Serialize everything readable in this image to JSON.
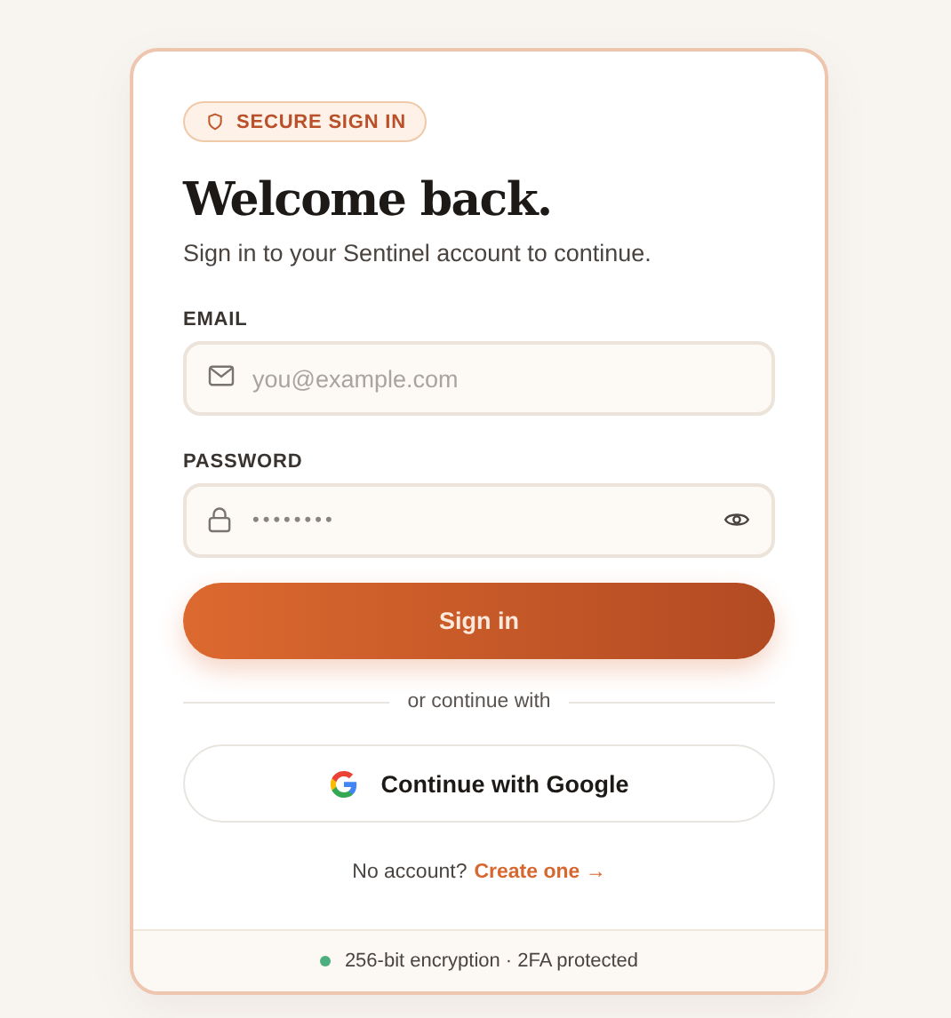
{
  "badge": "SECURE SIGN IN",
  "title": "Welcome back.",
  "subtitle": "Sign in to your Sentinel account to continue.",
  "fields": [
    {
      "kind": "email",
      "label": "EMAIL",
      "placeholder": "you@example.com"
    },
    {
      "kind": "password",
      "label": "PASSWORD",
      "value": "••••••••"
    }
  ],
  "submit": "Sign in",
  "divider": "or continue with",
  "google_button": "Continue with Google",
  "signup": {
    "prompt": "No account?",
    "link": "Create one →"
  },
  "footer": "256-bit encryption · 2FA protected"
}
